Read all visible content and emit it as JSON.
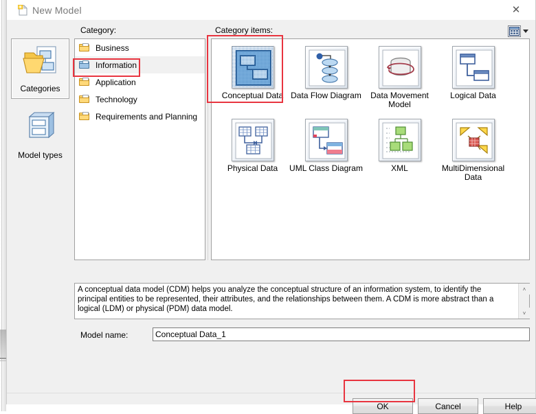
{
  "window": {
    "title": "New Model",
    "title_icon": "new-document-icon",
    "close_label": "✕"
  },
  "toolbar": {
    "view_mode_icon": "grid-view-icon",
    "view_mode_caret_icon": "chevron-down-icon"
  },
  "rail": {
    "buttons": [
      {
        "label": "Categories",
        "icon": "categories-folder-icon",
        "selected": true
      },
      {
        "label": "Model types",
        "icon": "model-types-cube-icon",
        "selected": false
      }
    ]
  },
  "category": {
    "caption": "Category:",
    "items": [
      {
        "label": "Business",
        "icon": "folder-icon",
        "selected": false
      },
      {
        "label": "Information",
        "icon": "folder-icon",
        "selected": true
      },
      {
        "label": "Application",
        "icon": "folder-icon",
        "selected": false
      },
      {
        "label": "Technology",
        "icon": "folder-icon",
        "selected": false
      },
      {
        "label": "Requirements and Planning",
        "icon": "folder-icon",
        "selected": false
      }
    ]
  },
  "category_items": {
    "caption": "Category items:",
    "items": [
      {
        "label": "Conceptual Data",
        "icon": "conceptual-data-icon",
        "selected": true
      },
      {
        "label": "Data Flow Diagram",
        "icon": "data-flow-diagram-icon",
        "selected": false
      },
      {
        "label": "Data Movement Model",
        "icon": "data-movement-model-icon",
        "selected": false
      },
      {
        "label": "Logical Data",
        "icon": "logical-data-icon",
        "selected": false
      },
      {
        "label": "Physical Data",
        "icon": "physical-data-icon",
        "selected": false
      },
      {
        "label": "UML Class Diagram",
        "icon": "uml-class-diagram-icon",
        "selected": false
      },
      {
        "label": "XML",
        "icon": "xml-icon",
        "selected": false
      },
      {
        "label": "MultiDimensional Data",
        "icon": "multidimensional-data-icon",
        "selected": false
      }
    ]
  },
  "description": {
    "text": "A conceptual data model (CDM) helps you analyze the conceptual structure of an information system, to identify the principal entities to be represented, their attributes, and the relationships between them. A CDM is more abstract than a logical (LDM) or physical (PDM) data model.",
    "scroll_up_icon": "˄",
    "scroll_down_icon": "˅"
  },
  "model_name": {
    "label": "Model name:",
    "value": "Conceptual Data_1",
    "placeholder": ""
  },
  "buttons": {
    "ok": "OK",
    "cancel": "Cancel",
    "help": "Help"
  },
  "colors": {
    "annotation": "#e8343f",
    "selection": "#f1f1f1",
    "dialog_bg": "#f0f0f0"
  }
}
